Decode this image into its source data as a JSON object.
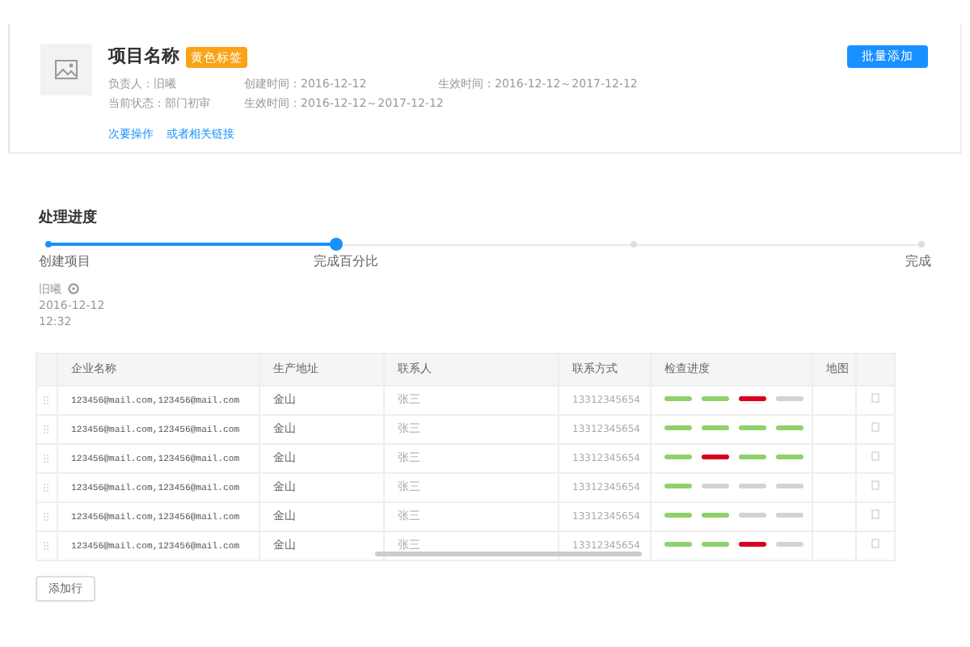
{
  "project": {
    "title": "项目名称",
    "tag": "黄色标签",
    "fields": [
      "负责人：旧曦",
      "创建时间：2016-12-12",
      "生效时间：2016-12-12～2017-12-12",
      "当前状态：部门初审",
      "生效时间：2016-12-12～2017-12-12"
    ],
    "links": [
      "次要操作",
      "或者相关链接"
    ],
    "action": "批量添加"
  },
  "progress": {
    "title": "处理进度",
    "level": 0.33,
    "steps": [
      {
        "label": "创建项目",
        "done": true
      },
      {
        "label": "完成百分比",
        "done": true
      },
      {
        "done": false
      },
      {
        "label": "完成",
        "done": false
      }
    ],
    "log": {
      "user": "旧曦",
      "date": "2016-12-12",
      "time": "12:32"
    }
  },
  "table": {
    "columns": [
      "企业名称",
      "生产地址",
      "联系人",
      "联系方式",
      "检查进度",
      "地图"
    ],
    "rows": [
      {
        "company": "123456@mail.com,123456@mail.com",
        "address": "金山",
        "contact": "张三",
        "phone": "13312345654",
        "checks": [
          {
            "color": "#8fd16a"
          },
          {
            "color": "#8fd16a"
          },
          {
            "color": "#d9001b"
          },
          {
            "color": "#d3d3d3"
          }
        ]
      },
      {
        "company": "123456@mail.com,123456@mail.com",
        "address": "金山",
        "contact": "张三",
        "phone": "13312345654",
        "checks": [
          {
            "color": "#8fd16a"
          },
          {
            "color": "#8fd16a"
          },
          {
            "color": "#8fd16a"
          },
          {
            "color": "#8fd16a"
          }
        ]
      },
      {
        "company": "123456@mail.com,123456@mail.com",
        "address": "金山",
        "contact": "张三",
        "phone": "13312345654",
        "checks": [
          {
            "color": "#8fd16a"
          },
          {
            "color": "#d9001b"
          },
          {
            "color": "#8fd16a"
          },
          {
            "color": "#8fd16a"
          }
        ]
      },
      {
        "company": "123456@mail.com,123456@mail.com",
        "address": "金山",
        "contact": "张三",
        "phone": "13312345654",
        "checks": [
          {
            "color": "#8fd16a"
          },
          {
            "color": "#d3d3d3"
          },
          {
            "color": "#d3d3d3"
          },
          {
            "color": "#d3d3d3"
          }
        ]
      },
      {
        "company": "123456@mail.com,123456@mail.com",
        "address": "金山",
        "contact": "张三",
        "phone": "13312345654",
        "checks": [
          {
            "color": "#8fd16a"
          },
          {
            "color": "#8fd16a"
          },
          {
            "color": "#d3d3d3"
          },
          {
            "color": "#d3d3d3"
          }
        ]
      },
      {
        "company": "123456@mail.com,123456@mail.com",
        "address": "金山",
        "contact": "张三",
        "phone": "13312345654",
        "checks": [
          {
            "color": "#8fd16a"
          },
          {
            "color": "#8fd16a"
          },
          {
            "color": "#d9001b"
          },
          {
            "color": "#d3d3d3"
          }
        ]
      }
    ],
    "add_button": "添加行"
  }
}
